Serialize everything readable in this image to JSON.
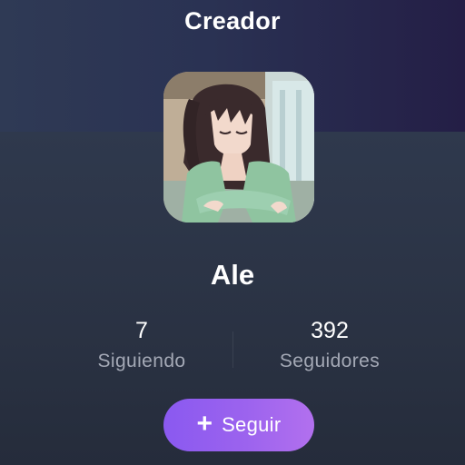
{
  "header": {
    "title": "Creador"
  },
  "profile": {
    "avatar_icon": "anime-character-avatar",
    "name": "Ale"
  },
  "stats": {
    "following": {
      "value": "7",
      "label": "Siguiendo"
    },
    "followers": {
      "value": "392",
      "label": "Seguidores"
    }
  },
  "actions": {
    "follow_icon": "plus-icon",
    "follow_label": "Seguir",
    "accent": "#9a62ef"
  }
}
